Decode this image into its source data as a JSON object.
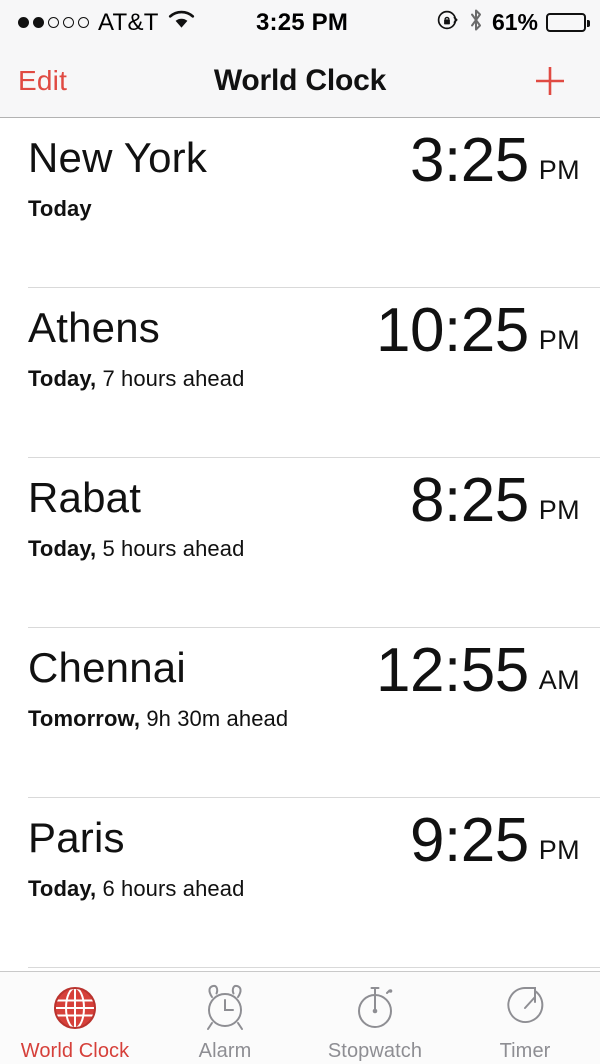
{
  "status_bar": {
    "signal_dots": {
      "total": 5,
      "filled": 2
    },
    "carrier": "AT&T",
    "wifi_icon": "wifi-icon",
    "time": "3:25 PM",
    "rotation_lock_icon": "rotation-lock-icon",
    "bluetooth_icon": "bluetooth-icon",
    "battery_percent": "61%",
    "battery_level": 61
  },
  "nav_bar": {
    "edit_label": "Edit",
    "title": "World Clock",
    "add_icon": "plus-icon",
    "accent_color": "#e04a42"
  },
  "clocks": [
    {
      "city": "New York",
      "day": "Today",
      "offset": "",
      "time": "3:25",
      "ampm": "PM"
    },
    {
      "city": "Athens",
      "day": "Today,",
      "offset": " 7 hours ahead",
      "time": "10:25",
      "ampm": "PM"
    },
    {
      "city": "Rabat",
      "day": "Today,",
      "offset": " 5 hours ahead",
      "time": "8:25",
      "ampm": "PM"
    },
    {
      "city": "Chennai",
      "day": "Tomorrow,",
      "offset": " 9h 30m ahead",
      "time": "12:55",
      "ampm": "AM"
    },
    {
      "city": "Paris",
      "day": "Today,",
      "offset": " 6 hours ahead",
      "time": "9:25",
      "ampm": "PM"
    }
  ],
  "tab_bar": {
    "active_color": "#d6403a",
    "inactive_color": "#8e8e93",
    "tabs": [
      {
        "label": "World Clock",
        "icon": "globe-icon",
        "active": true
      },
      {
        "label": "Alarm",
        "icon": "alarm-clock-icon",
        "active": false
      },
      {
        "label": "Stopwatch",
        "icon": "stopwatch-icon",
        "active": false
      },
      {
        "label": "Timer",
        "icon": "timer-icon",
        "active": false
      }
    ]
  }
}
